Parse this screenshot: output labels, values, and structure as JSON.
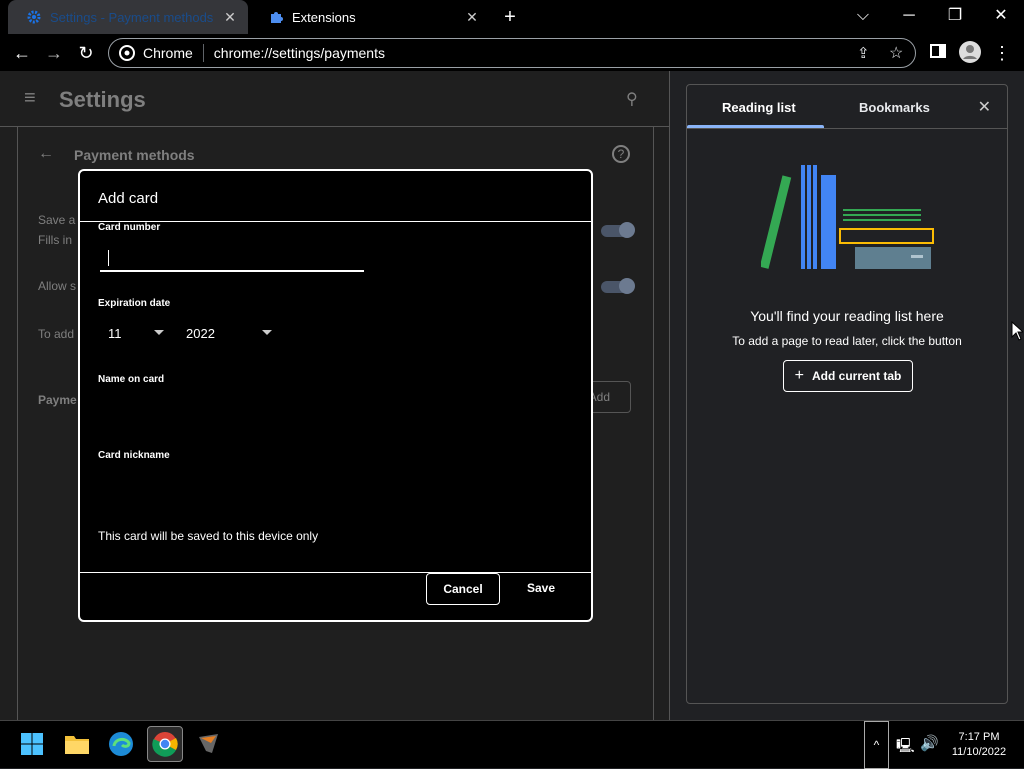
{
  "tabs": [
    {
      "label": "Settings - Payment methods",
      "icon": "gear-icon"
    },
    {
      "label": "Extensions",
      "icon": "puzzle-icon"
    }
  ],
  "omnibox": {
    "chip": "Chrome",
    "url": "chrome://settings/payments"
  },
  "settings": {
    "title": "Settings",
    "section": "Payment methods",
    "row1_line1": "Save a",
    "row1_line2": "Fills in",
    "row2": "Allow s",
    "row3": "To add",
    "payments_label": "Payme",
    "add_button": "Add"
  },
  "dialog": {
    "title": "Add card",
    "card_number_label": "Card number",
    "card_number_value": "",
    "expiration_label": "Expiration date",
    "month": "11",
    "year": "2022",
    "name_label": "Name on card",
    "nickname_label": "Card nickname",
    "info": "This card will be saved to this device only",
    "cancel": "Cancel",
    "save": "Save"
  },
  "side_panel": {
    "tab_reading": "Reading list",
    "tab_bookmarks": "Bookmarks",
    "empty_title": "You'll find your reading list here",
    "empty_sub": "To add a page to read later, click the button",
    "add_button": "Add current tab"
  },
  "taskbar": {
    "time": "7:17 PM",
    "date": "11/10/2022"
  },
  "colors": {
    "accent": "#8ab4f8",
    "books_green": "#34a853",
    "books_blue": "#4285f4",
    "books_yellow": "#fbbc04"
  }
}
